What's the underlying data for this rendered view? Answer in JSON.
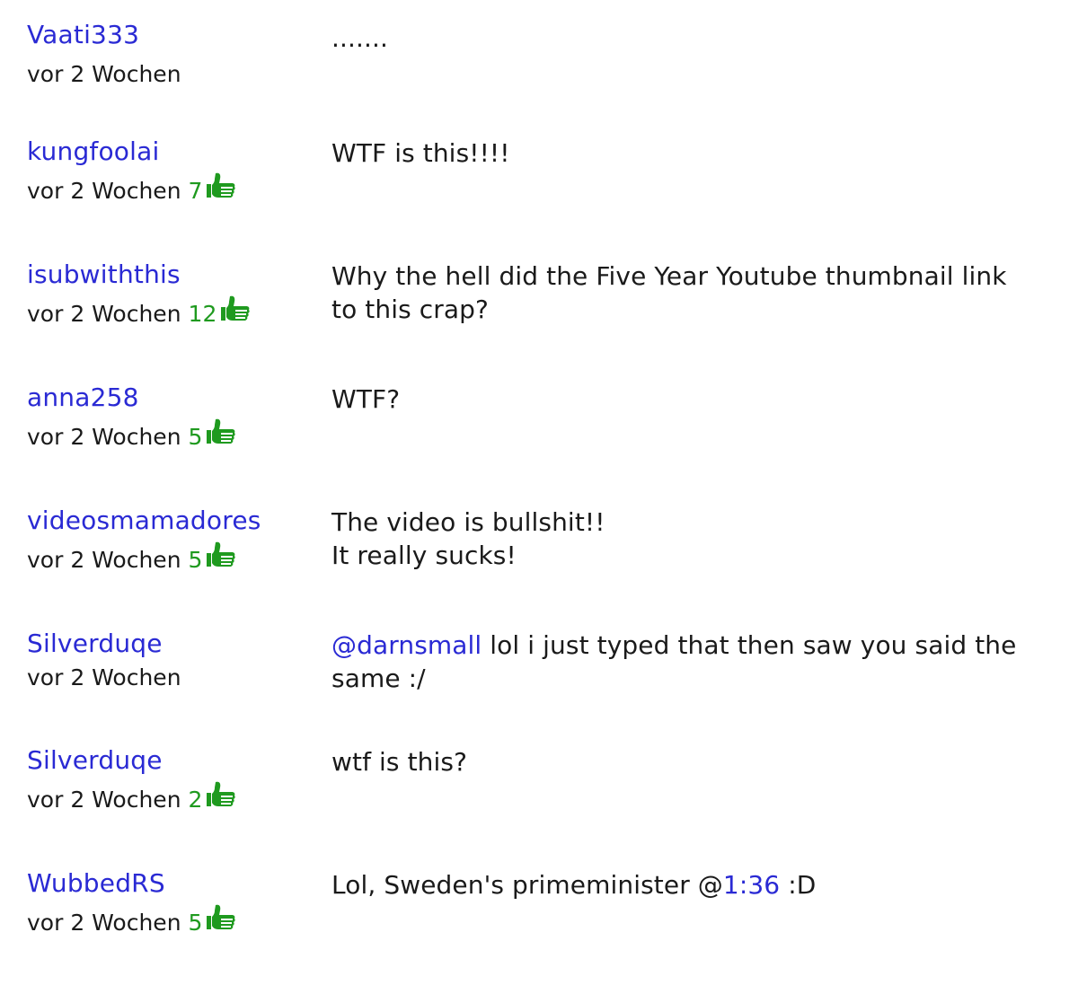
{
  "comments": [
    {
      "user": "Vaati333",
      "time": "vor 2 Wochen",
      "votes": "",
      "text": "......."
    },
    {
      "user": "kungfoolai",
      "time": "vor 2 Wochen",
      "votes": "7",
      "text": "WTF is this!!!!"
    },
    {
      "user": "isubwiththis",
      "time": "vor 2 Wochen",
      "votes": "12",
      "text_line1": "Why the hell did the Five Year Youtube thumbnail link",
      "text_line2": "to this crap?"
    },
    {
      "user": "anna258",
      "time": "vor 2 Wochen",
      "votes": "5",
      "text": "WTF?"
    },
    {
      "user": "videosmamadores",
      "time": "vor 2 Wochen",
      "votes": "5",
      "text_line1": "The video is bullshit!!",
      "text_line2": "It really sucks!"
    },
    {
      "user": "Silverduqe",
      "time": "vor 2 Wochen",
      "votes": "",
      "mention": "@darnsmall",
      "text_line1_rest": " lol i just typed that then saw you said the",
      "text_line2": "same :/"
    },
    {
      "user": "Silverduqe",
      "time": "vor 2 Wochen",
      "votes": "2",
      "text": "wtf is this?"
    },
    {
      "user": "WubbedRS",
      "time": "vor 2 Wochen",
      "votes": "5",
      "text_before": "Lol, Sweden's primeminister @",
      "timelink": "1:36",
      "text_after": " :D"
    }
  ],
  "colors": {
    "link": "#2a2ad4",
    "votes": "#1f9a1f",
    "text": "#1a1a1a"
  },
  "icons": {
    "thumb": "thumbs-up-icon"
  }
}
